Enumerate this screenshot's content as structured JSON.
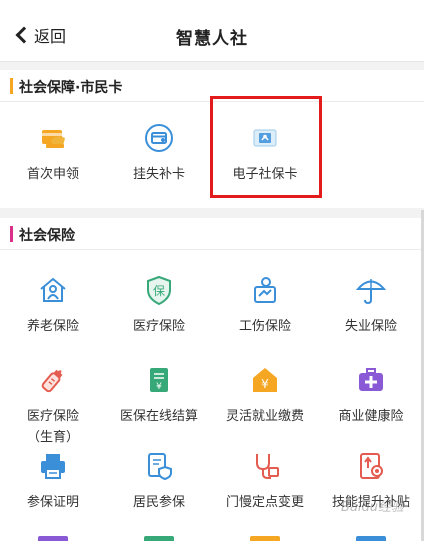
{
  "header": {
    "back_label": "返回",
    "title": "智慧人社"
  },
  "section1": {
    "title": "社会保障·市民卡",
    "bar_color": "#f5a623",
    "items": [
      {
        "label": "首次申领",
        "icon": "card-apply-icon"
      },
      {
        "label": "挂失补卡",
        "icon": "card-replace-icon"
      },
      {
        "label": "电子社保卡",
        "icon": "e-social-card-icon"
      }
    ]
  },
  "section2": {
    "title": "社会保险",
    "bar_color": "#d9308a",
    "items": [
      {
        "label": "养老保险",
        "icon": "house-elder-icon"
      },
      {
        "label": "医疗保险",
        "icon": "shield-bao-icon"
      },
      {
        "label": "工伤保险",
        "icon": "injury-clipboard-icon"
      },
      {
        "label": "失业保险",
        "icon": "umbrella-icon"
      },
      {
        "label": "医疗保险",
        "label2": "（生育）",
        "icon": "baby-bottle-icon"
      },
      {
        "label": "医保在线结算",
        "icon": "settlement-receipt-icon"
      },
      {
        "label": "灵活就业缴费",
        "icon": "yen-house-icon"
      },
      {
        "label": "商业健康险",
        "icon": "medical-kit-icon"
      },
      {
        "label": "参保证明",
        "icon": "printer-icon"
      },
      {
        "label": "居民参保",
        "icon": "document-shield-icon"
      },
      {
        "label": "门慢定点变更",
        "icon": "stethoscope-icon"
      },
      {
        "label": "技能提升补贴",
        "icon": "certificate-icon"
      }
    ]
  },
  "watermark": "Baidu经验",
  "colors": {
    "orange": "#f5a623",
    "blue": "#3b8fd9",
    "green": "#37a877",
    "red": "#e45b4f",
    "purple": "#8a5ad6",
    "highlight": "#e31b1b"
  }
}
